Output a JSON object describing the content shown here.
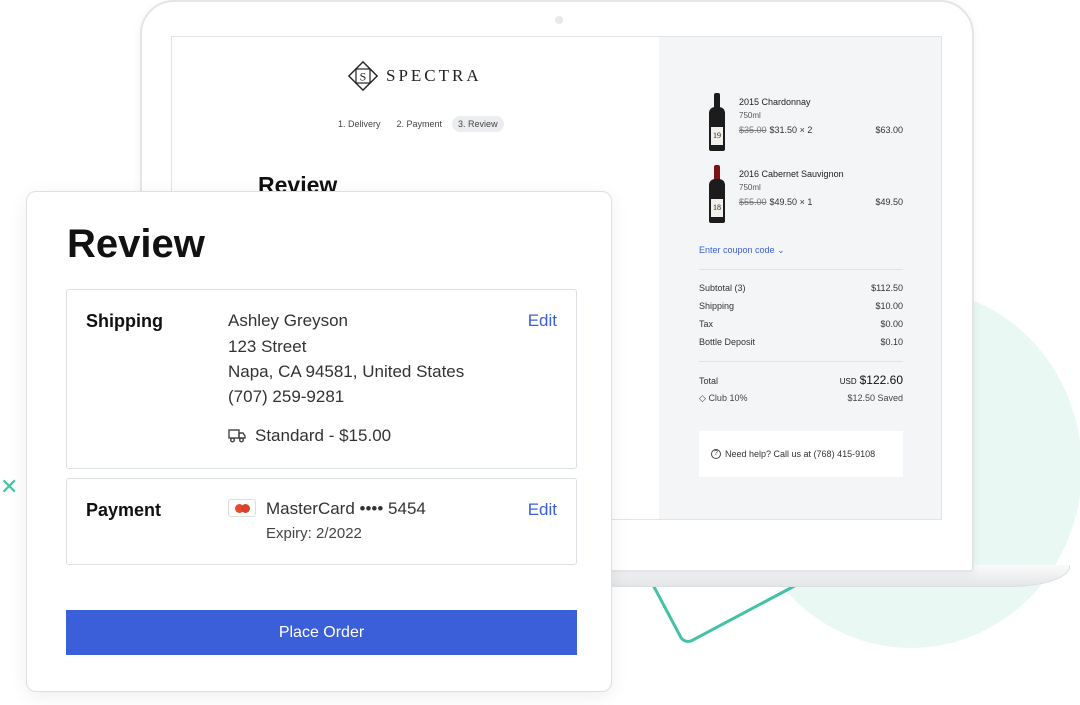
{
  "brand": {
    "name": "SPECTRA"
  },
  "steps": [
    {
      "label": "1. Delivery"
    },
    {
      "label": "2. Payment"
    },
    {
      "label": "3. Review"
    }
  ],
  "screen": {
    "title": "Review"
  },
  "cart": {
    "items": [
      {
        "name": "2015 Chardonnay",
        "volume": "750ml",
        "original_price": "$35.00",
        "price": "$31.50",
        "qty": "× 2",
        "total": "$63.00",
        "label_num": "19"
      },
      {
        "name": "2016 Cabernet Sauvignon",
        "volume": "750ml",
        "original_price": "$55.00",
        "price": "$49.50",
        "qty": "× 1",
        "total": "$49.50",
        "label_num": "18"
      }
    ],
    "coupon_link": "Enter coupon code",
    "summary": [
      {
        "label": "Subtotal (3)",
        "value": "$112.50"
      },
      {
        "label": "Shipping",
        "value": "$10.00"
      },
      {
        "label": "Tax",
        "value": "$0.00"
      },
      {
        "label": "Bottle Deposit",
        "value": "$0.10"
      }
    ],
    "total_label": "Total",
    "currency": "USD",
    "total_value": "$122.60",
    "club_label": "Club 10%",
    "saved": "$12.50 Saved",
    "help": "Need help? Call us at (768) 415-9108"
  },
  "review": {
    "title": "Review",
    "shipping": {
      "label": "Shipping",
      "edit": "Edit",
      "name": "Ashley Greyson",
      "street": "123 Street",
      "city": "Napa, CA 94581, United States",
      "phone": "(707) 259-9281",
      "method": "Standard - $15.00"
    },
    "payment": {
      "label": "Payment",
      "edit": "Edit",
      "card": "MasterCard •••• 5454",
      "expiry": "Expiry: 2/2022"
    },
    "place_order": "Place Order"
  },
  "colors": {
    "accent": "#3a5fd9",
    "decor": "#43c2a6"
  }
}
